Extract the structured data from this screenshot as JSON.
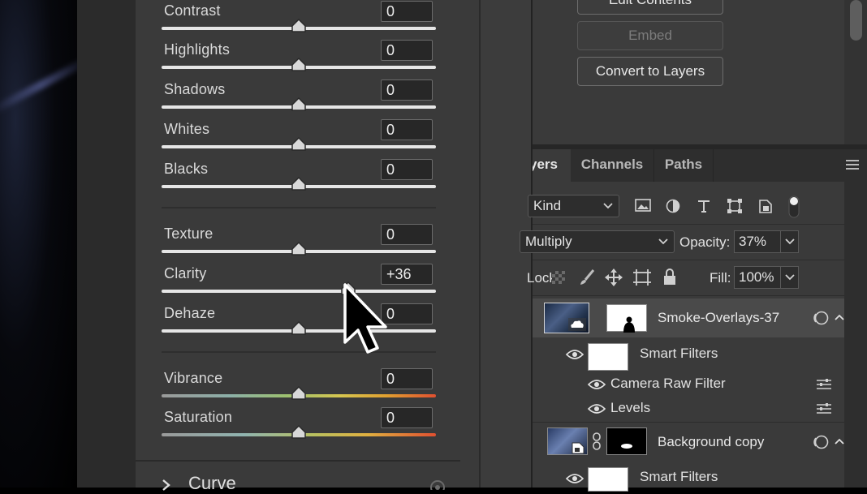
{
  "camera_raw": {
    "sliders": [
      {
        "label": "Contrast",
        "value": "0",
        "fraction": 0.5
      },
      {
        "label": "Highlights",
        "value": "0",
        "fraction": 0.5
      },
      {
        "label": "Shadows",
        "value": "0",
        "fraction": 0.5
      },
      {
        "label": "Whites",
        "value": "0",
        "fraction": 0.5
      },
      {
        "label": "Blacks",
        "value": "0",
        "fraction": 0.5
      },
      {
        "label": "Texture",
        "value": "0",
        "fraction": 0.5
      },
      {
        "label": "Clarity",
        "value": "+36",
        "fraction": 0.68
      },
      {
        "label": "Dehaze",
        "value": "0",
        "fraction": 0.5
      },
      {
        "label": "Vibrance",
        "value": "0",
        "fraction": 0.5
      },
      {
        "label": "Saturation",
        "value": "0",
        "fraction": 0.5
      }
    ],
    "curve_section": "Curve"
  },
  "properties": {
    "buttons": {
      "edit_contents": "Edit Contents",
      "embed": "Embed",
      "convert_to_layers": "Convert to Layers"
    }
  },
  "layers_panel": {
    "tabs": {
      "layers": "Layers",
      "channels": "Channels",
      "paths": "Paths"
    },
    "filter_kind": "Kind",
    "blend_mode": "Multiply",
    "opacity_label": "Opacity:",
    "opacity_value": "37%",
    "lock_label": "Lock:",
    "fill_label": "Fill:",
    "fill_value": "100%",
    "layers": [
      {
        "name": "Smoke-Overlays-37",
        "smart_filters": "Smart Filters",
        "filters": [
          "Camera Raw Filter",
          "Levels"
        ]
      },
      {
        "name": "Background copy",
        "smart_filters": "Smart Filters"
      }
    ]
  },
  "colors": {
    "panel_bg": "#3a3a3a",
    "field_bg": "#272727",
    "selected_row": "#4a4a4a"
  }
}
